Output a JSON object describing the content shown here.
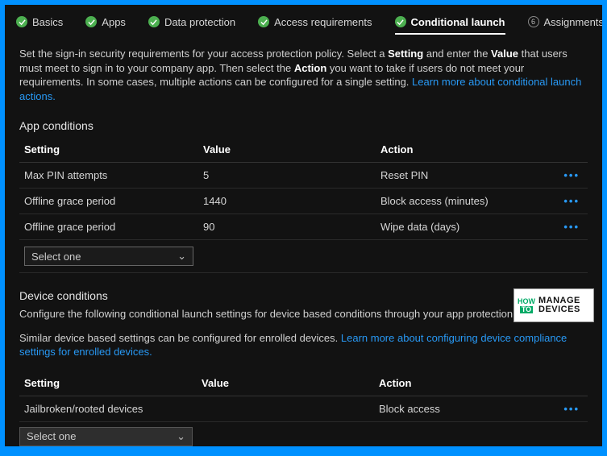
{
  "tabs": {
    "basics": "Basics",
    "apps": "Apps",
    "data": "Data protection",
    "access": "Access requirements",
    "cond": "Conditional launch",
    "assign_num": "6",
    "assign": "Assignments"
  },
  "intro": {
    "p1a": "Set the sign-in security requirements for your access protection policy. Select a ",
    "b1": "Setting",
    "p1b": " and enter the ",
    "b2": "Value",
    "p1c": " that users must meet to sign in to your company app. Then select the ",
    "b3": "Action",
    "p1d": " you want to take if users do not meet your requirements. In some cases, multiple actions can be configured for a single setting. ",
    "link": "Learn more about conditional launch actions."
  },
  "app": {
    "title": "App conditions",
    "headers": {
      "setting": "Setting",
      "value": "Value",
      "action": "Action"
    },
    "rows": [
      {
        "setting": "Max PIN attempts",
        "value": "5",
        "action": "Reset PIN"
      },
      {
        "setting": "Offline grace period",
        "value": "1440",
        "action": "Block access (minutes)"
      },
      {
        "setting": "Offline grace period",
        "value": "90",
        "action": "Wipe data (days)"
      }
    ],
    "select": "Select one"
  },
  "device": {
    "title": "Device conditions",
    "desc": "Configure the following conditional launch settings for device based conditions through your app protection policy.",
    "note1": "Similar device based settings can be configured for enrolled devices. ",
    "link": "Learn more about configuring device compliance settings for enrolled devices.",
    "headers": {
      "setting": "Setting",
      "value": "Value",
      "action": "Action"
    },
    "rows": [
      {
        "setting": "Jailbroken/rooted devices",
        "value": "",
        "action": "Block access"
      }
    ],
    "select": "Select one"
  },
  "menu_dots": "•••",
  "watermark": {
    "how": "HOW",
    "to": "TO",
    "line1": "MANAGE",
    "line2": "DEVICES"
  }
}
